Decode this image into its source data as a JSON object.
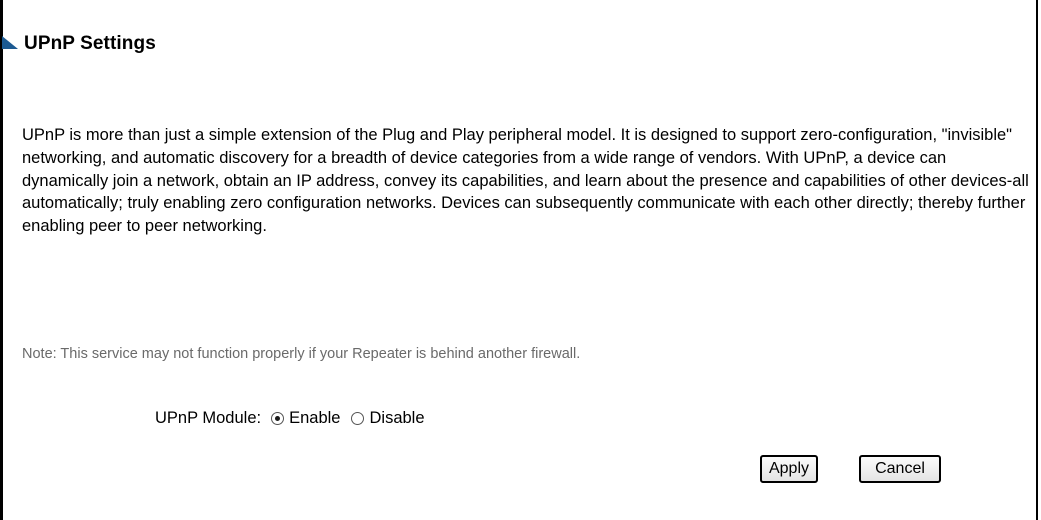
{
  "page": {
    "title": "UPnP Settings",
    "description": "UPnP is more than just a simple extension of the Plug and Play peripheral model. It is designed to support zero-configuration, \"invisible\" networking, and automatic discovery for a breadth of device categories from a wide range of vendors. With UPnP, a device can dynamically join a network, obtain an IP address, convey its capabilities, and learn about the presence and capabilities of other devices-all automatically; truly enabling zero configuration networks. Devices can subsequently communicate with each other directly; thereby further enabling peer to peer networking.",
    "note": "Note: This service may not function properly if your Repeater is behind another firewall."
  },
  "upnp_module": {
    "label": "UPnP Module:",
    "selected": "Enable",
    "options": [
      {
        "label": "Enable",
        "checked": true
      },
      {
        "label": "Disable",
        "checked": false
      }
    ]
  },
  "buttons": {
    "apply": "Apply",
    "cancel": "Cancel"
  },
  "colors": {
    "marker": "#1c5a92",
    "note_text": "#6a6a6a"
  },
  "icons": {
    "marker": "triangle-marker-icon"
  }
}
